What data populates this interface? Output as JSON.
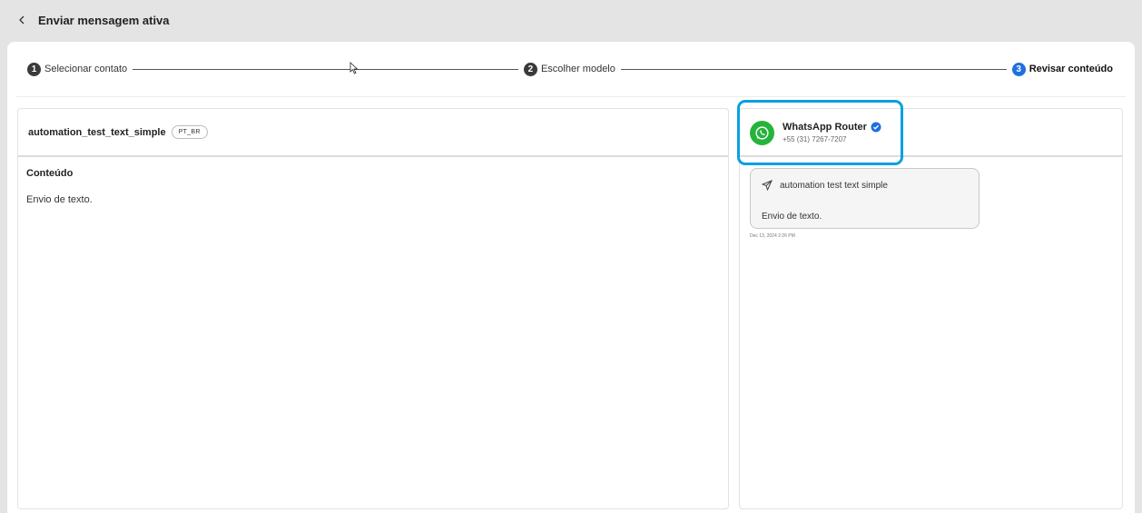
{
  "header": {
    "title": "Enviar mensagem ativa"
  },
  "stepper": {
    "steps": [
      {
        "number": "1",
        "label": "Selecionar contato"
      },
      {
        "number": "2",
        "label": "Escolher modelo"
      },
      {
        "number": "3",
        "label": "Revisar conteúdo"
      }
    ],
    "active_step": "3"
  },
  "template": {
    "name": "automation_test_text_simple",
    "language": "PT_BR",
    "section_title": "Conteúdo",
    "body": "Envio de texto."
  },
  "preview": {
    "sender_name": "WhatsApp Router",
    "sender_phone": "+55 (31) 7267-7207",
    "message_title": "automation test text simple",
    "message_body": "Envio de texto.",
    "timestamp": "Dec 13, 2024 2:26 PM"
  },
  "icons": {
    "back": "chevron-left-icon",
    "whatsapp": "whatsapp-icon",
    "verified": "verified-badge-icon",
    "send": "paper-plane-icon"
  },
  "colors": {
    "accent": "#1f6fe0",
    "whatsapp": "#25b43b",
    "highlight": "#0aa0e0"
  }
}
